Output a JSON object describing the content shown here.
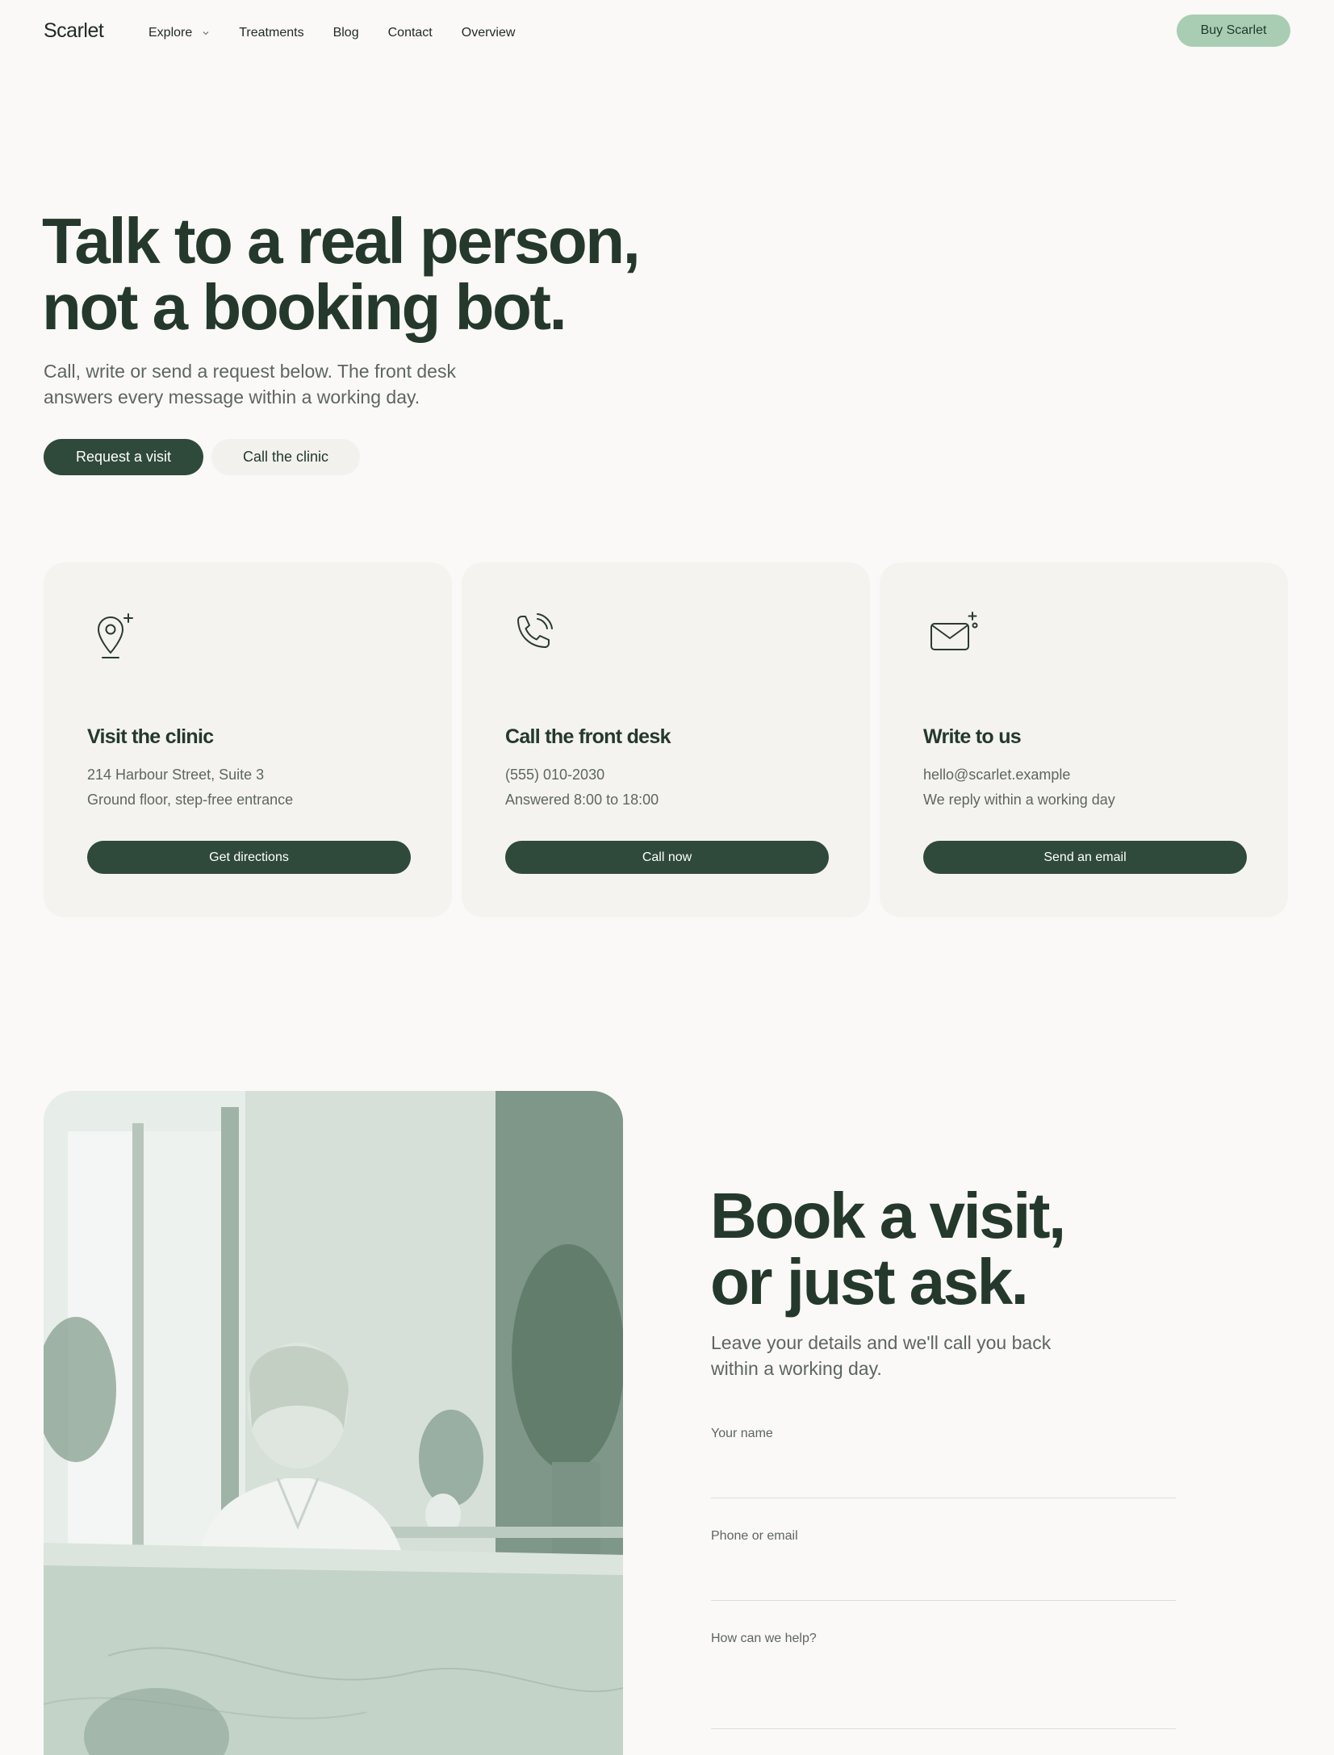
{
  "brand": {
    "logo": "Scarlet"
  },
  "nav": {
    "items": [
      {
        "label": "Explore"
      },
      {
        "label": "Treatments"
      },
      {
        "label": "Blog"
      },
      {
        "label": "Contact"
      },
      {
        "label": "Overview"
      }
    ],
    "buy_label": "Buy Scarlet"
  },
  "hero": {
    "title_line1": "Talk to a real person,",
    "title_line2": "not a booking bot.",
    "subtitle_line1": "Call, write or send a request below. The front desk",
    "subtitle_line2": "answers every message within a working day.",
    "primary_cta": "Request a visit",
    "secondary_cta": "Call the clinic"
  },
  "cards": [
    {
      "icon": "map-pin-icon",
      "title": "Visit the clinic",
      "line1": "214 Harbour Street, Suite 3",
      "line2": "Ground floor, step-free entrance",
      "button": "Get directions"
    },
    {
      "icon": "phone-icon",
      "title": "Call the front desk",
      "line1": "(555) 010-2030",
      "line2": "Answered 8:00 to 18:00",
      "button": "Call now"
    },
    {
      "icon": "mail-icon",
      "title": "Write to us",
      "line1": "hello@scarlet.example",
      "line2": "We reply within a working day",
      "button": "Send an email"
    }
  ],
  "booking": {
    "title_line1": "Book a visit,",
    "title_line2": "or just ask.",
    "subtitle_line1": "Leave your details and we'll call you back",
    "subtitle_line2": "within a working day.",
    "fields": [
      {
        "label": "Your name",
        "value": ""
      },
      {
        "label": "Phone or email",
        "value": ""
      },
      {
        "label": "How can we help?",
        "value": ""
      }
    ]
  },
  "colors": {
    "background": "#faf9f7",
    "primary": "#2f4a3a",
    "accent": "#a8cdb3",
    "card": "#f4f3ef",
    "heading": "#24392c",
    "muted": "#5e6661"
  }
}
